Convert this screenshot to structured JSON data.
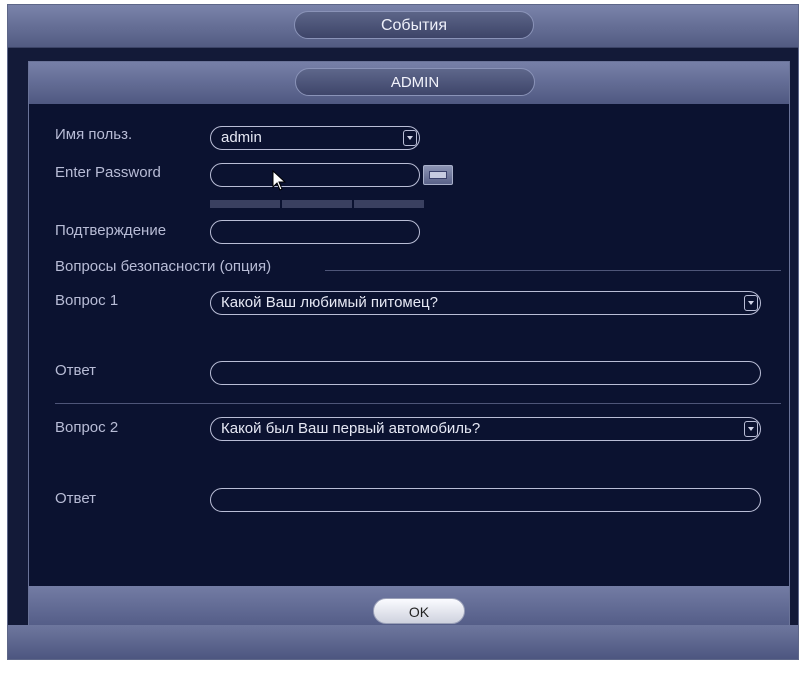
{
  "window": {
    "title": "События"
  },
  "dialog": {
    "title": "ADMIN",
    "ok_label": "OK"
  },
  "form": {
    "username_label": "Имя польз.",
    "username_value": "admin",
    "password_label": "Enter Password",
    "password_value": "",
    "confirm_label": "Подтверждение",
    "confirm_value": "",
    "security_section": "Вопросы безопасности (опция)",
    "q1_label": "Вопрос 1",
    "q1_value": "Какой Ваш любимый питомец?",
    "a1_label": "Ответ",
    "a1_value": "",
    "q2_label": "Вопрос 2",
    "q2_value": "Какой был Ваш первый автомобиль?",
    "a2_label": "Ответ",
    "a2_value": ""
  },
  "icons": {
    "keyboard": "keyboard-icon",
    "dropdown": "chevron-down-icon",
    "cursor": "mouse-cursor-icon"
  },
  "colors": {
    "background": "#0b1230",
    "bar": "#6e779e",
    "text": "#b8bcd6"
  }
}
